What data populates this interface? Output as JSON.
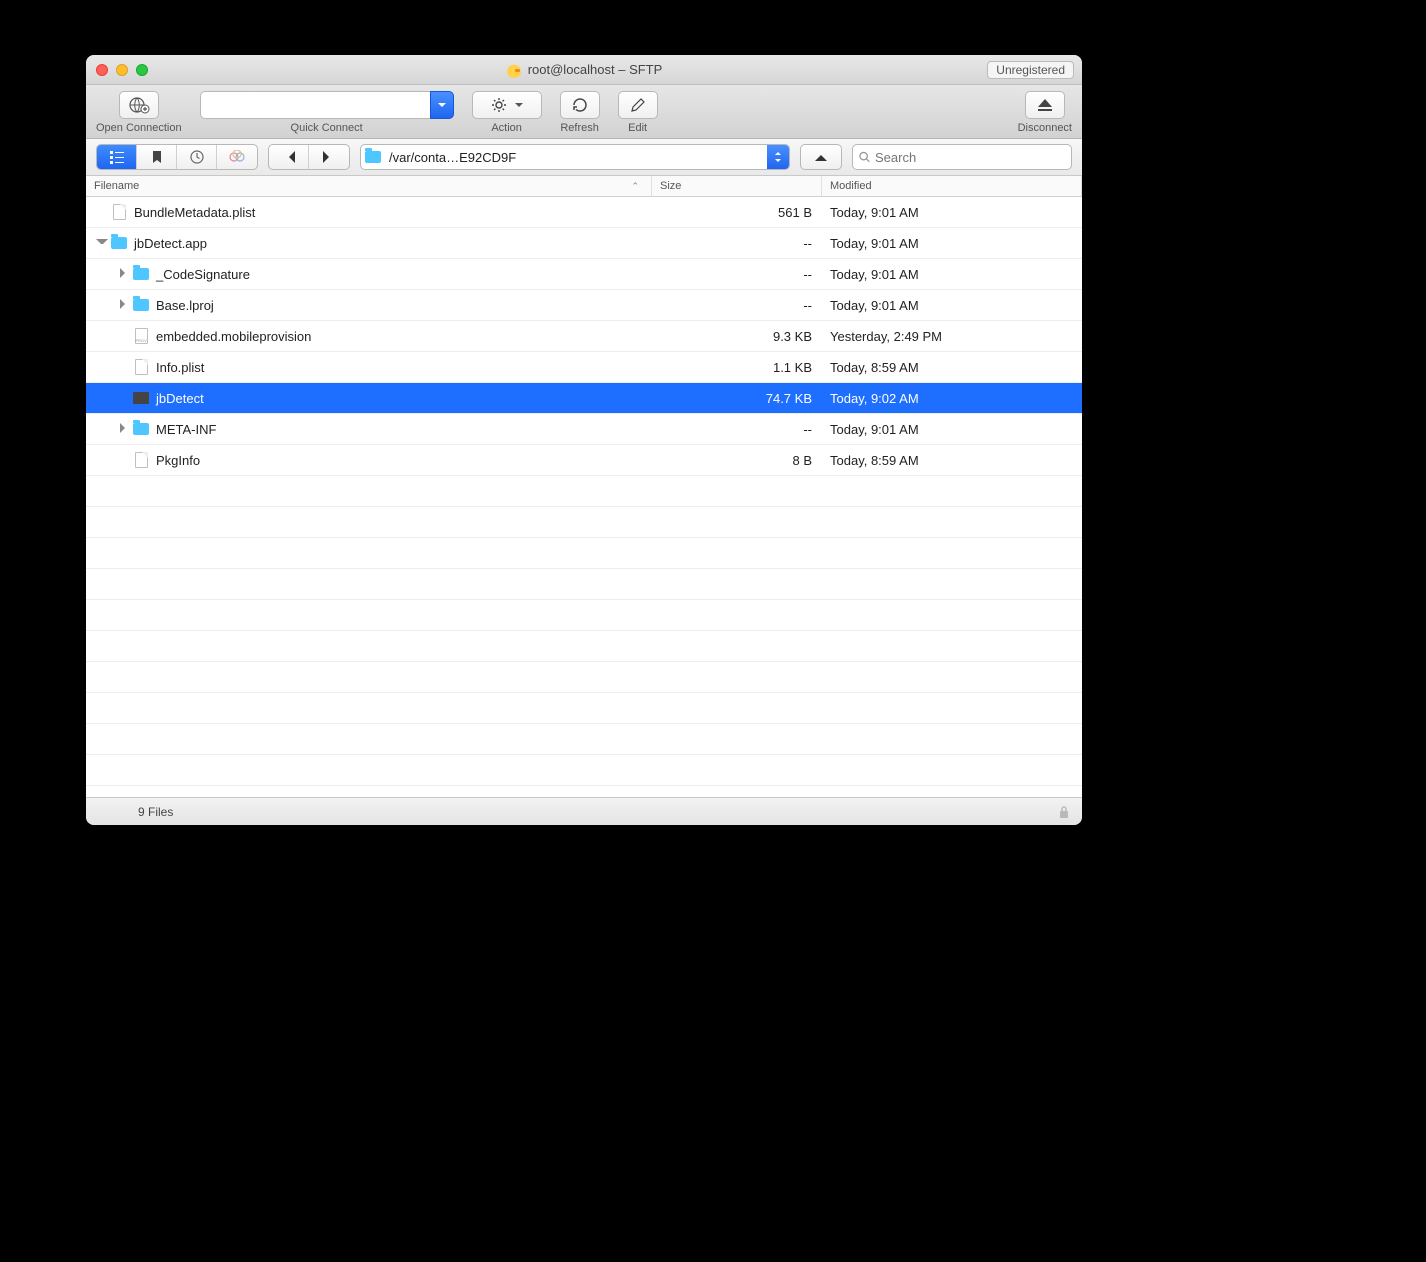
{
  "window": {
    "title": "root@localhost – SFTP",
    "unregistered_badge": "Unregistered"
  },
  "toolbar": {
    "open_connection": "Open Connection",
    "quick_connect": "Quick Connect",
    "quick_connect_value": "",
    "action": "Action",
    "refresh": "Refresh",
    "edit": "Edit",
    "disconnect": "Disconnect"
  },
  "viewbar": {
    "path": "/var/conta…E92CD9F",
    "search_placeholder": "Search"
  },
  "columns": {
    "name": "Filename",
    "size": "Size",
    "modified": "Modified"
  },
  "files": [
    {
      "name": "BundleMetadata.plist",
      "size": "561 B",
      "modified": "Today, 9:01 AM",
      "indent": 0,
      "type": "file",
      "expand": "",
      "selected": false
    },
    {
      "name": "jbDetect.app",
      "size": "--",
      "modified": "Today, 9:01 AM",
      "indent": 0,
      "type": "folder",
      "expand": "down",
      "selected": false
    },
    {
      "name": "_CodeSignature",
      "size": "--",
      "modified": "Today, 9:01 AM",
      "indent": 1,
      "type": "folder",
      "expand": "right",
      "selected": false
    },
    {
      "name": "Base.lproj",
      "size": "--",
      "modified": "Today, 9:01 AM",
      "indent": 1,
      "type": "folder",
      "expand": "right",
      "selected": false
    },
    {
      "name": "embedded.mobileprovision",
      "size": "9.3 KB",
      "modified": "Yesterday, 2:49 PM",
      "indent": 1,
      "type": "prov",
      "expand": "",
      "selected": false
    },
    {
      "name": "Info.plist",
      "size": "1.1 KB",
      "modified": "Today, 8:59 AM",
      "indent": 1,
      "type": "file",
      "expand": "",
      "selected": false
    },
    {
      "name": "jbDetect",
      "size": "74.7 KB",
      "modified": "Today, 9:02 AM",
      "indent": 1,
      "type": "exec",
      "expand": "",
      "selected": true
    },
    {
      "name": "META-INF",
      "size": "--",
      "modified": "Today, 9:01 AM",
      "indent": 1,
      "type": "folder",
      "expand": "right",
      "selected": false
    },
    {
      "name": "PkgInfo",
      "size": "8 B",
      "modified": "Today, 8:59 AM",
      "indent": 1,
      "type": "file",
      "expand": "",
      "selected": false
    }
  ],
  "status": {
    "count_text": "9 Files"
  }
}
